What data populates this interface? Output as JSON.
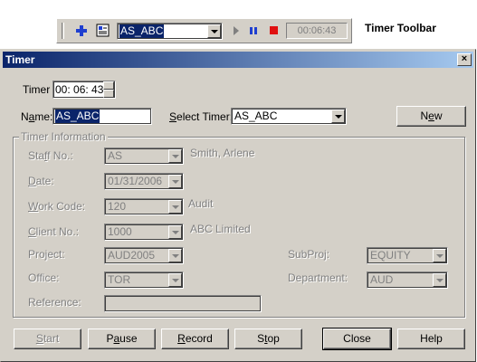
{
  "toolbar": {
    "caption": "Timer Toolbar",
    "combo_value": "AS_ABC",
    "timer_value": "00:06:43",
    "colors": {
      "add": "#1f3fd0",
      "pause": "#1f3fd0",
      "record": "#e01010",
      "stop": "#1f3fd0"
    },
    "icons": [
      "add-icon",
      "timer-window-icon",
      "play-icon",
      "pause-icon",
      "record-icon",
      "stop-icon"
    ]
  },
  "dialog": {
    "title": "Timer",
    "close_glyph": "×",
    "timer_label": "Timer",
    "timer_value": "00: 06: 43",
    "name_label_pre": "N",
    "name_label_u": "a",
    "name_label_post": "me:",
    "name_value": "AS_ABC",
    "select_timer_label_u": "S",
    "select_timer_label_post": "elect Timer:",
    "select_timer_value": "AS_ABC",
    "new_button_pre": "N",
    "new_button_u": "e",
    "new_button_post": "w",
    "group_title": "Timer Information",
    "fields": {
      "staff": {
        "label_pre": "Sta",
        "label_u": "f",
        "label_post": "f No.:",
        "value": "AS",
        "info": "Smith, Arlene"
      },
      "date": {
        "label_u": "D",
        "label_post": "ate:",
        "value": "01/31/2006"
      },
      "work_code": {
        "label_u": "W",
        "label_post": "ork Code:",
        "value": "120",
        "info": "Audit"
      },
      "client": {
        "label_u": "C",
        "label_post": "lient No.:",
        "value": "1000",
        "info": "ABC Limited"
      },
      "project": {
        "label": "Project:",
        "value": "AUD2005"
      },
      "subproj": {
        "label": "SubProj:",
        "value": "EQUITY"
      },
      "office": {
        "label": "Office:",
        "value": "TOR"
      },
      "department": {
        "label": "Department:",
        "value": "AUD"
      },
      "reference": {
        "label": "Reference:",
        "value": ""
      }
    },
    "buttons": {
      "start": {
        "u": "S",
        "post": "tart"
      },
      "pause": {
        "pre": "P",
        "u": "a",
        "post": "use"
      },
      "record": {
        "u": "R",
        "post": "ecord"
      },
      "stop": {
        "pre": "S",
        "u": "t",
        "post": "op"
      },
      "close": "Close",
      "help": "Help"
    }
  }
}
